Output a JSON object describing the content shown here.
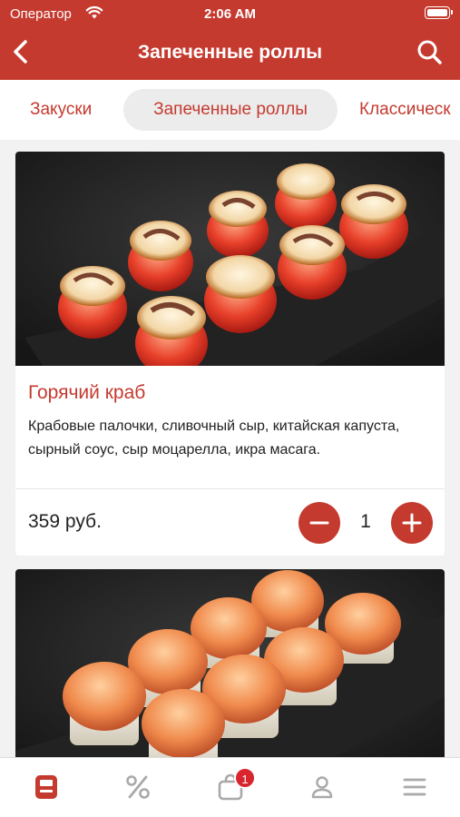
{
  "status_bar": {
    "carrier": "Оператор",
    "time": "2:06 AM"
  },
  "header": {
    "title": "Запеченные роллы"
  },
  "category_tabs": [
    {
      "label": "Закуски",
      "selected": false
    },
    {
      "label": "Запеченные роллы",
      "selected": true
    },
    {
      "label": "Классическ",
      "selected": false
    }
  ],
  "products": [
    {
      "name": "Горячий краб",
      "description": "Крабовые палочки, сливочный сыр, китайская капуста, сырный соус, сыр моцарелла, икра масага.",
      "price": "359 руб.",
      "quantity": "1"
    }
  ],
  "tabbar": {
    "items": [
      {
        "icon": "menu-card-icon",
        "active": true
      },
      {
        "icon": "percent-icon",
        "active": false
      },
      {
        "icon": "shopping-bag-icon",
        "active": false,
        "badge": "1"
      },
      {
        "icon": "profile-icon",
        "active": false
      },
      {
        "icon": "hamburger-menu-icon",
        "active": false
      }
    ]
  },
  "colors": {
    "brand": "#c53a2f",
    "inactive_icon": "#a9a9a9",
    "badge": "#d8262e"
  }
}
